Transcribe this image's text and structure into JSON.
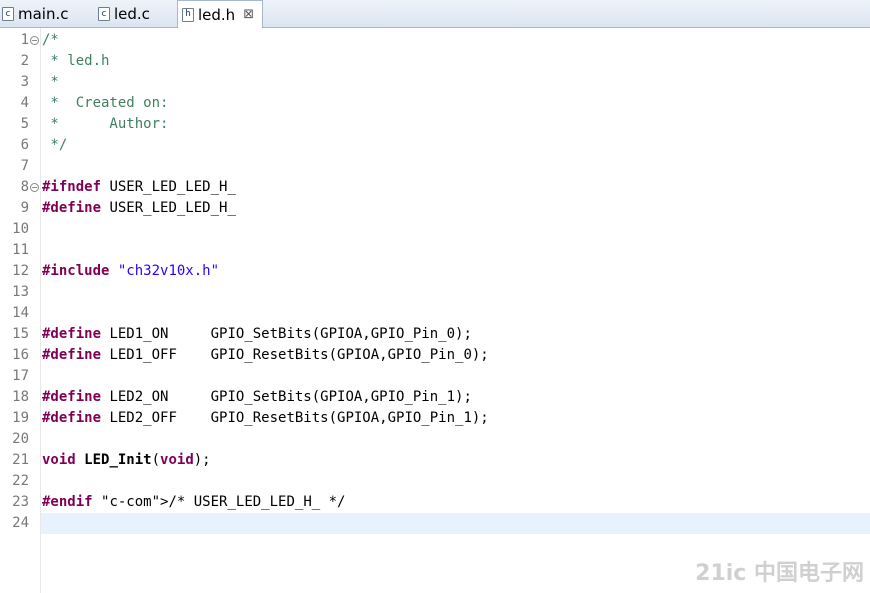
{
  "tabs": [
    {
      "icon": "c-file-icon",
      "icon_glyph": "c",
      "label": "main.c",
      "active": false
    },
    {
      "icon": "c-file-icon",
      "icon_glyph": "c",
      "label": "led.c",
      "active": false
    },
    {
      "icon": "h-file-icon",
      "icon_glyph": "h",
      "label": "led.h",
      "active": true,
      "close": "⊠"
    }
  ],
  "editor": {
    "line_numbers": [
      "1",
      "2",
      "3",
      "4",
      "5",
      "6",
      "7",
      "8",
      "9",
      "10",
      "11",
      "12",
      "13",
      "14",
      "15",
      "16",
      "17",
      "18",
      "19",
      "20",
      "21",
      "22",
      "23",
      "24"
    ],
    "lines": [
      "/*",
      " * led.h",
      " *",
      " *  Created on:",
      " *      Author:",
      " */",
      "",
      "#ifndef USER_LED_LED_H_",
      "#define USER_LED_LED_H_",
      "",
      "",
      "#include \"ch32v10x.h\"",
      "",
      "",
      "#define LED1_ON     GPIO_SetBits(GPIOA,GPIO_Pin_0);",
      "#define LED1_OFF    GPIO_ResetBits(GPIOA,GPIO_Pin_0);",
      "",
      "#define LED2_ON     GPIO_SetBits(GPIOA,GPIO_Pin_1);",
      "#define LED2_OFF    GPIO_ResetBits(GPIOA,GPIO_Pin_1);",
      "",
      "void LED_Init(void);",
      "",
      "#endif /* USER_LED_LED_H_ */",
      ""
    ]
  },
  "watermark": "21ic 中国电子网",
  "colors": {
    "comment": "#3f7f5f",
    "keyword": "#7f0055",
    "string": "#2a00ff",
    "current_line": "#e8f2fe"
  }
}
